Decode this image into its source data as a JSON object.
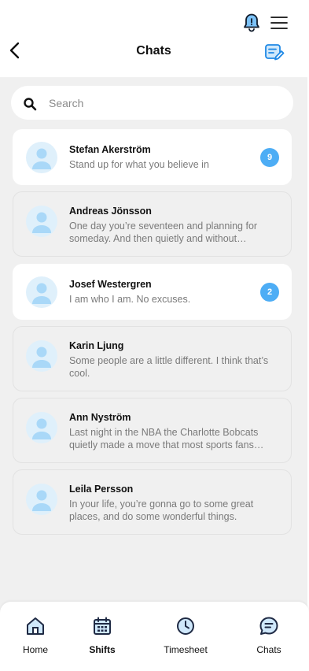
{
  "header": {
    "title": "Chats",
    "icons": [
      "bell-icon",
      "menu-icon",
      "back-arrow-icon",
      "compose-icon"
    ]
  },
  "search": {
    "placeholder": "Search",
    "value": ""
  },
  "chats": [
    {
      "name": "Stefan Akerström",
      "message": "Stand up for what you believe in",
      "unread": "9"
    },
    {
      "name": "Andreas Jönsson",
      "message": "One day you’re seventeen and planning for someday. And then quietly and without…",
      "unread": ""
    },
    {
      "name": "Josef Westergren",
      "message": "I am who I am. No excuses.",
      "unread": "2"
    },
    {
      "name": "Karin Ljung",
      "message": "Some people are a little different. I think that’s cool.",
      "unread": ""
    },
    {
      "name": "Ann Nyström",
      "message": "Last night in the NBA the Charlotte Bobcats quietly made a move that most sports fans…",
      "unread": ""
    },
    {
      "name": "Leila Persson",
      "message": "In your life, you’re gonna go to some great places, and do some wonderful things.",
      "unread": ""
    }
  ],
  "tabbar": {
    "tabs": [
      {
        "label": "Home",
        "icon": "home-icon"
      },
      {
        "label": "Shifts",
        "icon": "calendar-icon"
      },
      {
        "label": "Timesheet",
        "icon": "clock-icon"
      },
      {
        "label": "Chats",
        "icon": "chat-icon"
      }
    ]
  },
  "colors": {
    "accent": "#1e88e5",
    "badge": "#4dadf5",
    "avatar_bg": "#dff0fb",
    "page_bg": "#f0f0f0"
  }
}
